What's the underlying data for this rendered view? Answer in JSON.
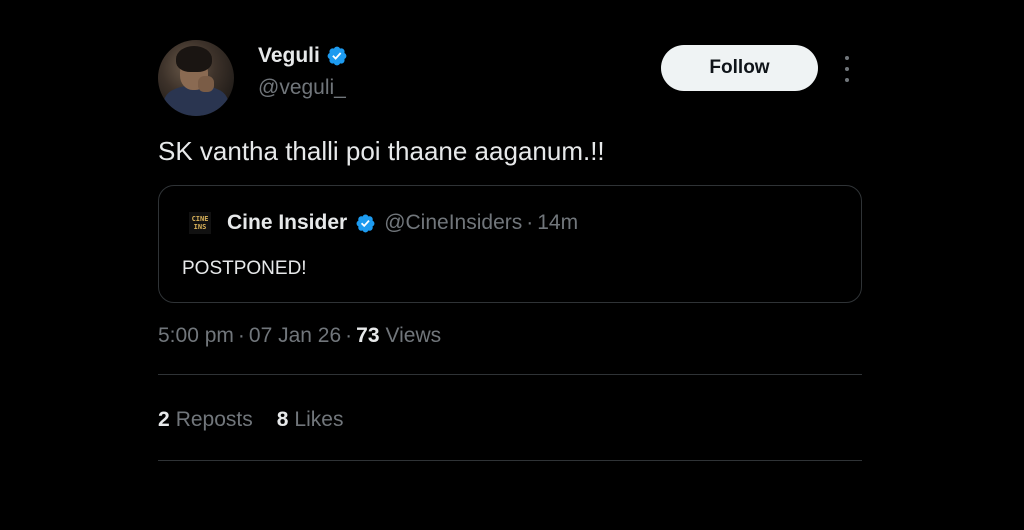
{
  "author": {
    "display_name": "Veguli",
    "handle": "@veguli_",
    "verified_icon": "verified-badge-icon",
    "avatar_icon": "user-avatar"
  },
  "actions": {
    "follow_label": "Follow",
    "more_icon": "more-vertical-icon"
  },
  "tweet": {
    "text": "SK vantha thalli poi thaane aaganum.!!"
  },
  "quoted_tweet": {
    "logo_text": "CINE INS",
    "display_name": "Cine Insider",
    "handle": "@CineInsiders",
    "separator": "·",
    "time": "14m",
    "text": "POSTPONED!"
  },
  "meta": {
    "time": "5:00 pm",
    "separator": "·",
    "date": "07 Jan 26",
    "views_count": "73",
    "views_label": "Views"
  },
  "stats": {
    "reposts_count": "2",
    "reposts_label": "Reposts",
    "likes_count": "8",
    "likes_label": "Likes"
  },
  "colors": {
    "background": "#000000",
    "primary_text": "#e7e9ea",
    "secondary_text": "#71767b",
    "verified_blue": "#1d9bf0",
    "border": "#2f3336",
    "follow_bg": "#eff3f4"
  }
}
